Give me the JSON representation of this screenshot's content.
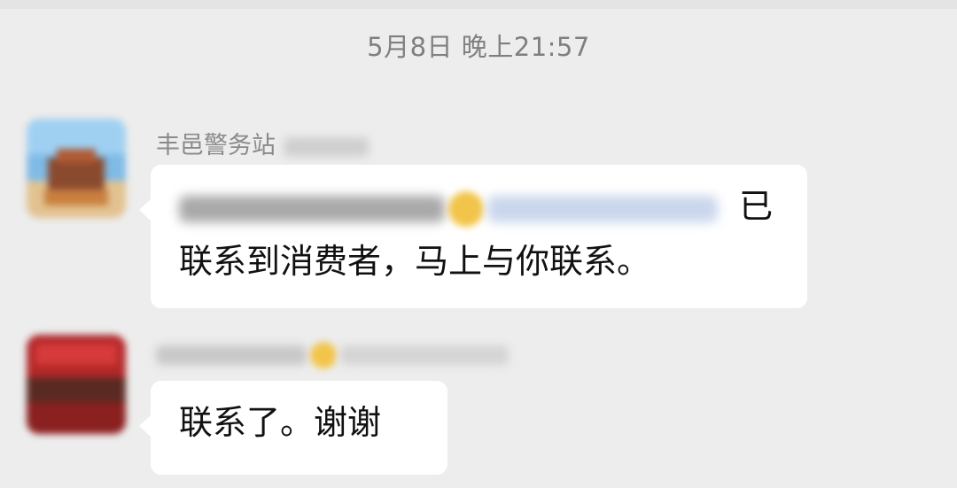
{
  "timestamp": "5月8日 晚上21:57",
  "messages": [
    {
      "sender_name": "丰邑警务站",
      "line1_tail": "已",
      "line2": "联系到消费者，马上与你联系。"
    },
    {
      "sender_name": "",
      "text": "联系了。谢谢"
    }
  ],
  "colors": {
    "background": "#ededed",
    "bubble": "#ffffff",
    "meta_text": "#7f7f7f"
  },
  "icons": [
    "avatar-station",
    "avatar-user",
    "emoji-blurred"
  ]
}
